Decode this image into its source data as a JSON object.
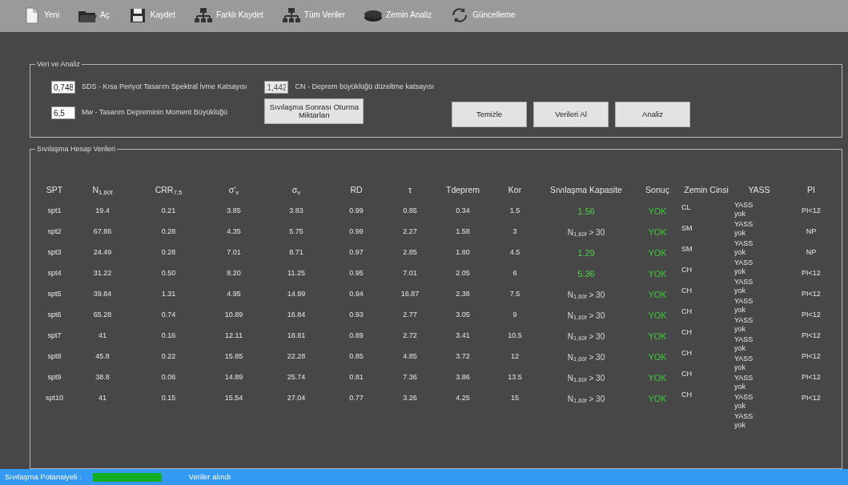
{
  "toolbar": [
    {
      "label": "Yeni"
    },
    {
      "label": "Aç"
    },
    {
      "label": "Kaydet"
    },
    {
      "label": "Farklı Kaydet"
    },
    {
      "label": "Tüm Veriler"
    },
    {
      "label": "Zemin Analiz"
    },
    {
      "label": "Güncelleme"
    }
  ],
  "input_group": {
    "title": "Veri ve Analiz",
    "fields": [
      {
        "value": "0,748",
        "label": "SDS - Kısa Periyot Tasarım Spektral İvme Katsayısı",
        "disabled": false
      },
      {
        "value": "1,442",
        "label": "CN - Deprem büyüklüğü düzeltme katsayısı",
        "disabled": true
      },
      {
        "value": "6,5",
        "label": "Mw - Tasarım Depreminin Moment Büyüklüğü",
        "disabled": false
      }
    ],
    "buttons": [
      "Sıvılaşma Sonrası Oturma Miktarları",
      "Temizle",
      "Verileri Al",
      "Analiz"
    ]
  },
  "table": {
    "title": "Sıvılaşma Hesap Verileri",
    "columns": [
      "SPT",
      "N$_{1,60f}$",
      "CRR$_{7,5}$",
      "σ'$_{v}$",
      "σ$_{v}$",
      "RD",
      "τ",
      "Tdeprem",
      "Kor",
      "Sıvılaşma Kapasite",
      "Sonuç",
      "Zemin Cinsi",
      "YASS",
      "PI"
    ],
    "rows": [
      {
        "spt": "spt1",
        "values": [
          "19.4",
          "0.21",
          "3.85",
          "3.83",
          "0.99",
          "0.85",
          "0.34",
          "1.5"
        ],
        "capacity": {
          "text": "1.56",
          "kind": "factor"
        },
        "result": "YOK",
        "soil": "CL",
        "pi": "PI<12"
      },
      {
        "spt": "spt2",
        "values": [
          "67.86",
          "0.28",
          "4.35",
          "5.75",
          "0.99",
          "2.27",
          "1.58",
          "3"
        ],
        "capacity": {
          "text": "N$_{1,60f}$ > 30",
          "kind": "limit"
        },
        "result": "YOK",
        "soil": "SM",
        "pi": "NP"
      },
      {
        "spt": "spt3",
        "values": [
          "24.49",
          "0.28",
          "7.01",
          "8.71",
          "0.97",
          "2.85",
          "1.80",
          "4.5"
        ],
        "capacity": {
          "text": "1.29",
          "kind": "factor"
        },
        "result": "YOK",
        "soil": "SM",
        "pi": "NP"
      },
      {
        "spt": "spt4",
        "values": [
          "31.22",
          "0.50",
          "8.20",
          "11.25",
          "0.95",
          "7.01",
          "2.05",
          "6"
        ],
        "capacity": {
          "text": "5.36",
          "kind": "factor"
        },
        "result": "YOK",
        "soil": "CH",
        "pi": "PI<12"
      },
      {
        "spt": "spt5",
        "values": [
          "39.84",
          "1.31",
          "4.95",
          "14.99",
          "0.94",
          "16.87",
          "2.38",
          "7.5"
        ],
        "capacity": {
          "text": "N$_{1,60f}$ > 30",
          "kind": "limit"
        },
        "result": "YOK",
        "soil": "CH",
        "pi": "PI<12"
      },
      {
        "spt": "spt6",
        "values": [
          "65.28",
          "0.74",
          "10.89",
          "16.84",
          "0.93",
          "2.77",
          "3.05",
          "9"
        ],
        "capacity": {
          "text": "N$_{1,60f}$ > 30",
          "kind": "limit"
        },
        "result": "YOK",
        "soil": "CH",
        "pi": "PI<12"
      },
      {
        "spt": "spt7",
        "values": [
          "41",
          "0.16",
          "12.11",
          "18.81",
          "0.89",
          "2.72",
          "3.41",
          "10.5"
        ],
        "capacity": {
          "text": "N$_{1,60f}$ > 30",
          "kind": "limit"
        },
        "result": "YOK",
        "soil": "CH",
        "pi": "PI<12"
      },
      {
        "spt": "spt8",
        "values": [
          "45.8",
          "0.22",
          "15.85",
          "22.28",
          "0.85",
          "4.85",
          "3.72",
          "12"
        ],
        "capacity": {
          "text": "N$_{1,60f}$ > 30",
          "kind": "limit"
        },
        "result": "YOK",
        "soil": "CH",
        "pi": "PI<12"
      },
      {
        "spt": "spt9",
        "values": [
          "38.8",
          "0.06",
          "14.89",
          "25.74",
          "0.81",
          "7.36",
          "3.86",
          "13.5"
        ],
        "capacity": {
          "text": "N$_{1,60f}$ > 30",
          "kind": "limit"
        },
        "result": "YOK",
        "soil": "CH",
        "pi": "PI<12"
      },
      {
        "spt": "spt10",
        "values": [
          "41",
          "0.15",
          "15.54",
          "27.04",
          "0.77",
          "3.26",
          "4.25",
          "15"
        ],
        "capacity": {
          "text": "N$_{1,60f}$ > 30",
          "kind": "limit"
        },
        "result": "YOK",
        "soil": "CH",
        "pi": "PI<12"
      }
    ],
    "yass_items": [
      "YASS yok",
      "YASS yok",
      "YASS yok",
      "YASS yok",
      "YASS yok",
      "YASS yok",
      "YASS yok",
      "YASS yok",
      "YASS yok",
      "YASS yok",
      "YASS yok",
      "YASS yok"
    ]
  },
  "status_bar": {
    "label": "Sıvılaşma Potansiyeli :",
    "message": "Veriler alındı"
  }
}
